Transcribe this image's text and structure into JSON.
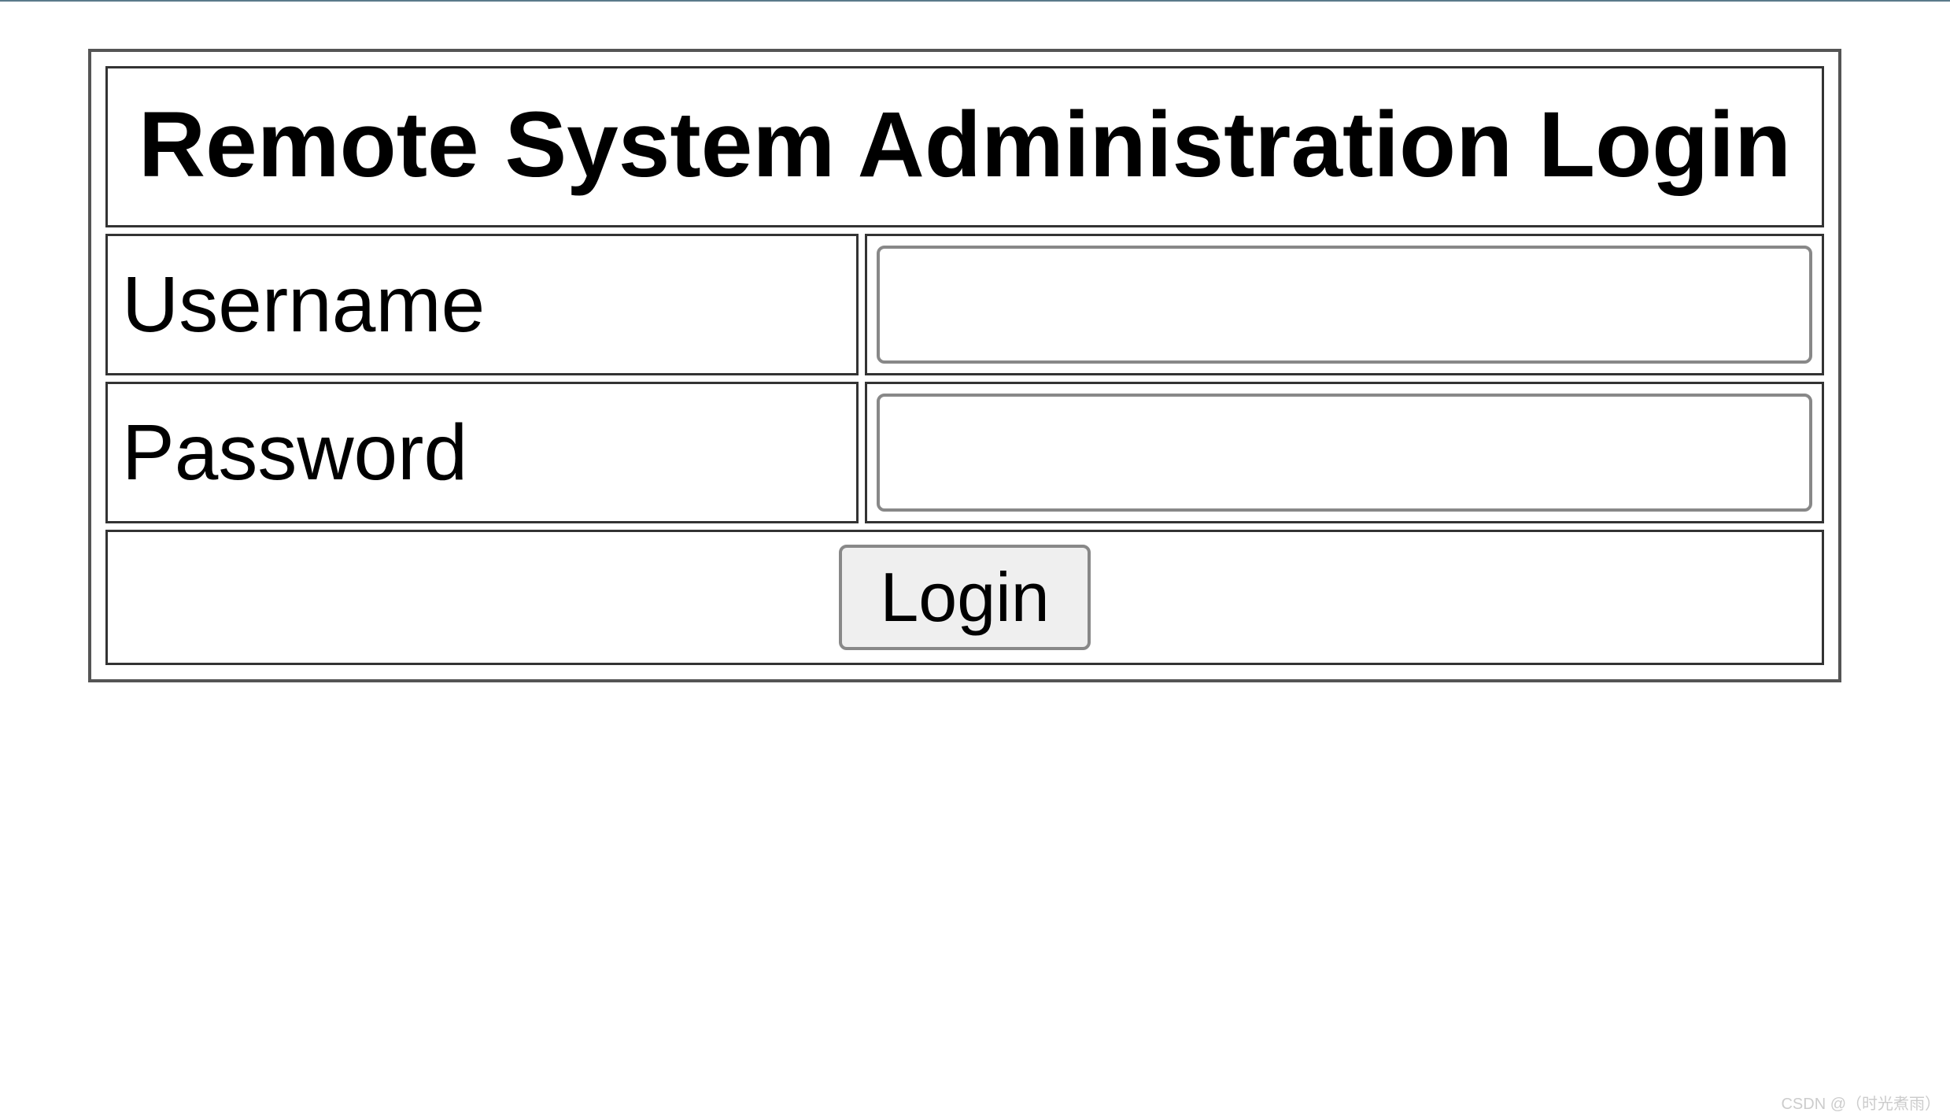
{
  "title": "Remote System Administration Login",
  "fields": {
    "username": {
      "label": "Username",
      "value": ""
    },
    "password": {
      "label": "Password",
      "value": ""
    }
  },
  "buttons": {
    "login_label": "Login"
  },
  "watermark": "CSDN @（时光煮雨）"
}
